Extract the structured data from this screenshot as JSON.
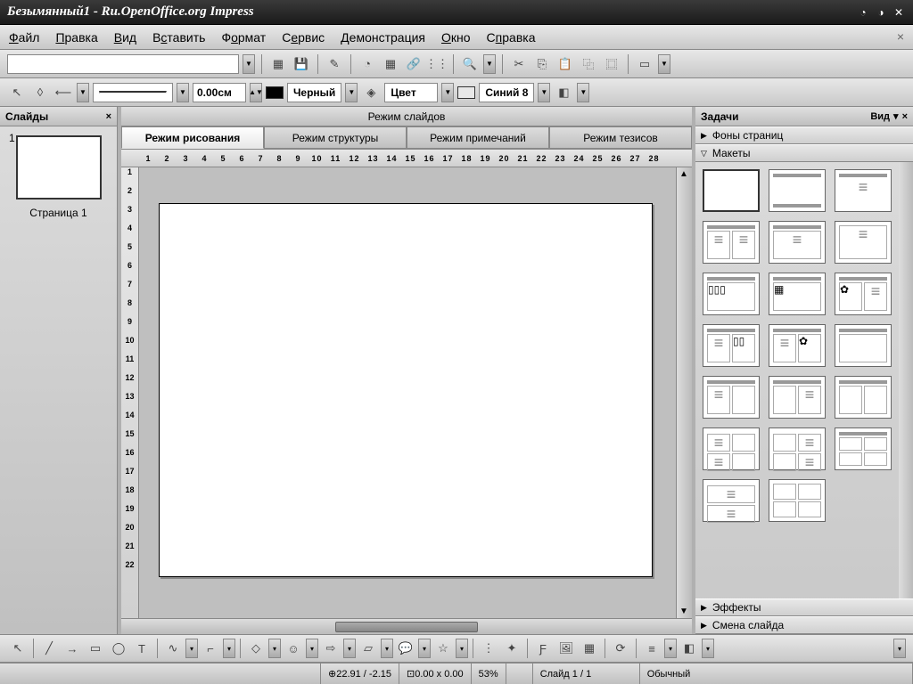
{
  "title": "Безымянный1 - Ru.OpenOffice.org Impress",
  "menu": [
    "Файл",
    "Правка",
    "Вид",
    "Вставить",
    "Формат",
    "Сервис",
    "Демонстрация",
    "Окно",
    "Справка"
  ],
  "toolbar2": {
    "line_width": "0.00см",
    "color1_label": "Черный",
    "fill_label": "Цвет",
    "color2_label": "Синий 8"
  },
  "slides_panel": {
    "title": "Слайды",
    "slide_num": "1",
    "slide_label": "Страница 1"
  },
  "center": {
    "title": "Режим слайдов",
    "tabs": [
      "Режим рисования",
      "Режим структуры",
      "Режим примечаний",
      "Режим тезисов"
    ],
    "ruler_h": [
      "1",
      "2",
      "3",
      "4",
      "5",
      "6",
      "7",
      "8",
      "9",
      "10",
      "11",
      "12",
      "13",
      "14",
      "15",
      "16",
      "17",
      "18",
      "19",
      "20",
      "21",
      "22",
      "23",
      "24",
      "25",
      "26",
      "27",
      "28"
    ],
    "ruler_v": [
      "1",
      "2",
      "3",
      "4",
      "5",
      "6",
      "7",
      "8",
      "9",
      "10",
      "11",
      "12",
      "13",
      "14",
      "15",
      "16",
      "17",
      "18",
      "19",
      "20",
      "21",
      "22"
    ]
  },
  "tasks": {
    "title": "Задачи",
    "view_label": "Вид",
    "sections": {
      "backgrounds": "Фоны страниц",
      "layouts": "Макеты",
      "effects": "Эффекты",
      "transition": "Смена слайда"
    }
  },
  "status": {
    "pos": "22.91 / -2.15",
    "size": "0.00 x 0.00",
    "zoom": "53%",
    "slide": "Слайд 1 / 1",
    "mode": "Обычный"
  }
}
